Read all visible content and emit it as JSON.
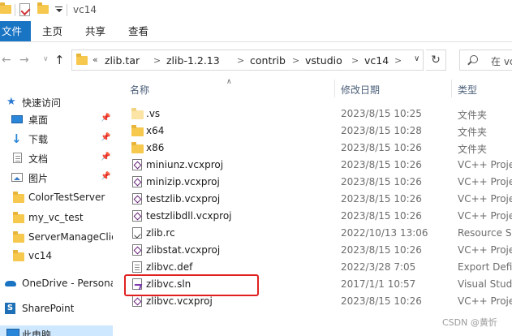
{
  "title_bar": {
    "title": "vc14",
    "quick_access_icons": [
      "folder-icon",
      "properties-check-icon",
      "new-folder-icon",
      "customize-dropdown-icon"
    ]
  },
  "ribbon": {
    "tabs": [
      "文件",
      "主页",
      "共享",
      "查看"
    ],
    "active_tab": "文件",
    "accent_color": "#1a74c4"
  },
  "nav": {
    "breadcrumb_overflow": "«",
    "breadcrumbs": [
      "zlib.tar",
      "zlib-1.2.13",
      "contrib",
      "vstudio",
      "vc14"
    ],
    "search_placeholder": "在 vc"
  },
  "sidebar": {
    "items": [
      {
        "label": "快速访问",
        "icon": "star-icon",
        "pinned": false
      },
      {
        "label": "桌面",
        "icon": "desktop-icon",
        "pinned": true
      },
      {
        "label": "下载",
        "icon": "download-icon",
        "pinned": true
      },
      {
        "label": "文档",
        "icon": "document-icon",
        "pinned": true
      },
      {
        "label": "图片",
        "icon": "pictures-icon",
        "pinned": true
      },
      {
        "label": "ColorTestServer",
        "icon": "folder-icon",
        "pinned": false
      },
      {
        "label": "my_vc_test",
        "icon": "folder-icon",
        "pinned": false
      },
      {
        "label": "ServerManageClie",
        "icon": "folder-icon",
        "pinned": false
      },
      {
        "label": "vc14",
        "icon": "folder-icon",
        "pinned": false
      },
      {
        "label": "OneDrive - Persona",
        "icon": "onedrive-cloud-icon",
        "pinned": false
      },
      {
        "label": "SharePoint",
        "icon": "sharepoint-icon",
        "pinned": false
      },
      {
        "label": "此电脑",
        "icon": "this-pc-icon",
        "pinned": false
      }
    ]
  },
  "file_list": {
    "columns": {
      "name": "名称",
      "date": "修改日期",
      "type": "类型"
    },
    "rows": [
      {
        "name": ".vs",
        "date": "2023/8/15 10:25",
        "type": "文件夹",
        "icon": "folder-hidden-icon"
      },
      {
        "name": "x64",
        "date": "2023/8/15 10:28",
        "type": "文件夹",
        "icon": "folder-icon"
      },
      {
        "name": "x86",
        "date": "2023/8/15 10:26",
        "type": "文件夹",
        "icon": "folder-icon"
      },
      {
        "name": "miniunz.vcxproj",
        "date": "2023/8/15 10:26",
        "type": "VC++ Proje",
        "icon": "vcxproj-icon"
      },
      {
        "name": "minizip.vcxproj",
        "date": "2023/8/15 10:26",
        "type": "VC++ Proje",
        "icon": "vcxproj-icon"
      },
      {
        "name": "testzlib.vcxproj",
        "date": "2023/8/15 10:26",
        "type": "VC++ Proje",
        "icon": "vcxproj-icon"
      },
      {
        "name": "testzlibdll.vcxproj",
        "date": "2023/8/15 10:26",
        "type": "VC++ Proje",
        "icon": "vcxproj-icon"
      },
      {
        "name": "zlib.rc",
        "date": "2022/10/13 13:06",
        "type": "Resource S",
        "icon": "resource-file-icon"
      },
      {
        "name": "zlibstat.vcxproj",
        "date": "2023/8/15 10:26",
        "type": "VC++ Proje",
        "icon": "vcxproj-icon"
      },
      {
        "name": "zlibvc.def",
        "date": "2022/3/28 7:05",
        "type": "Export Defi",
        "icon": "def-file-icon"
      },
      {
        "name": "zlibvc.sln",
        "date": "2017/1/1 10:57",
        "type": "Visual Studi",
        "icon": "visual-studio-solution-icon",
        "highlighted": true
      },
      {
        "name": "zlibvc.vcxproj",
        "date": "2023/8/15 10:26",
        "type": "VC++ Proje",
        "icon": "vcxproj-icon"
      }
    ],
    "highlight_color": "#e02020"
  },
  "watermark": "CSDN @黄忻"
}
